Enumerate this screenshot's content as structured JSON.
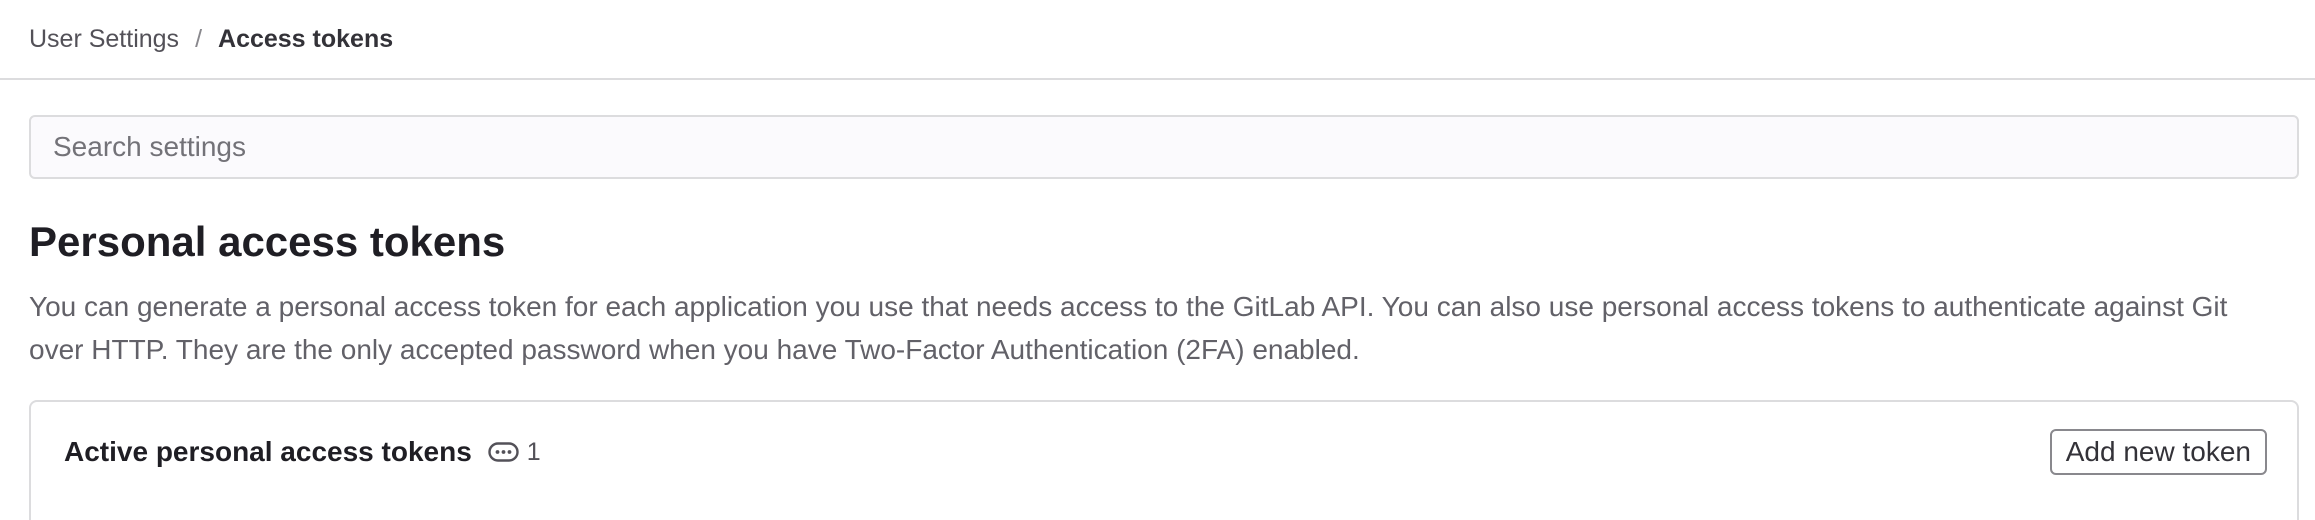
{
  "breadcrumb": {
    "parent": "User Settings",
    "separator": "/",
    "current": "Access tokens"
  },
  "search": {
    "placeholder": "Search settings",
    "value": ""
  },
  "section": {
    "title": "Personal access tokens",
    "description": "You can generate a personal access token for each application you use that needs access to the GitLab API. You can also use personal access tokens to authenticate against Git over HTTP. They are the only accepted password when you have Two-Factor Authentication (2FA) enabled."
  },
  "active_tokens": {
    "title": "Active personal access tokens",
    "count_icon": "token-icon",
    "count": "1",
    "add_button_label": "Add new token"
  }
}
